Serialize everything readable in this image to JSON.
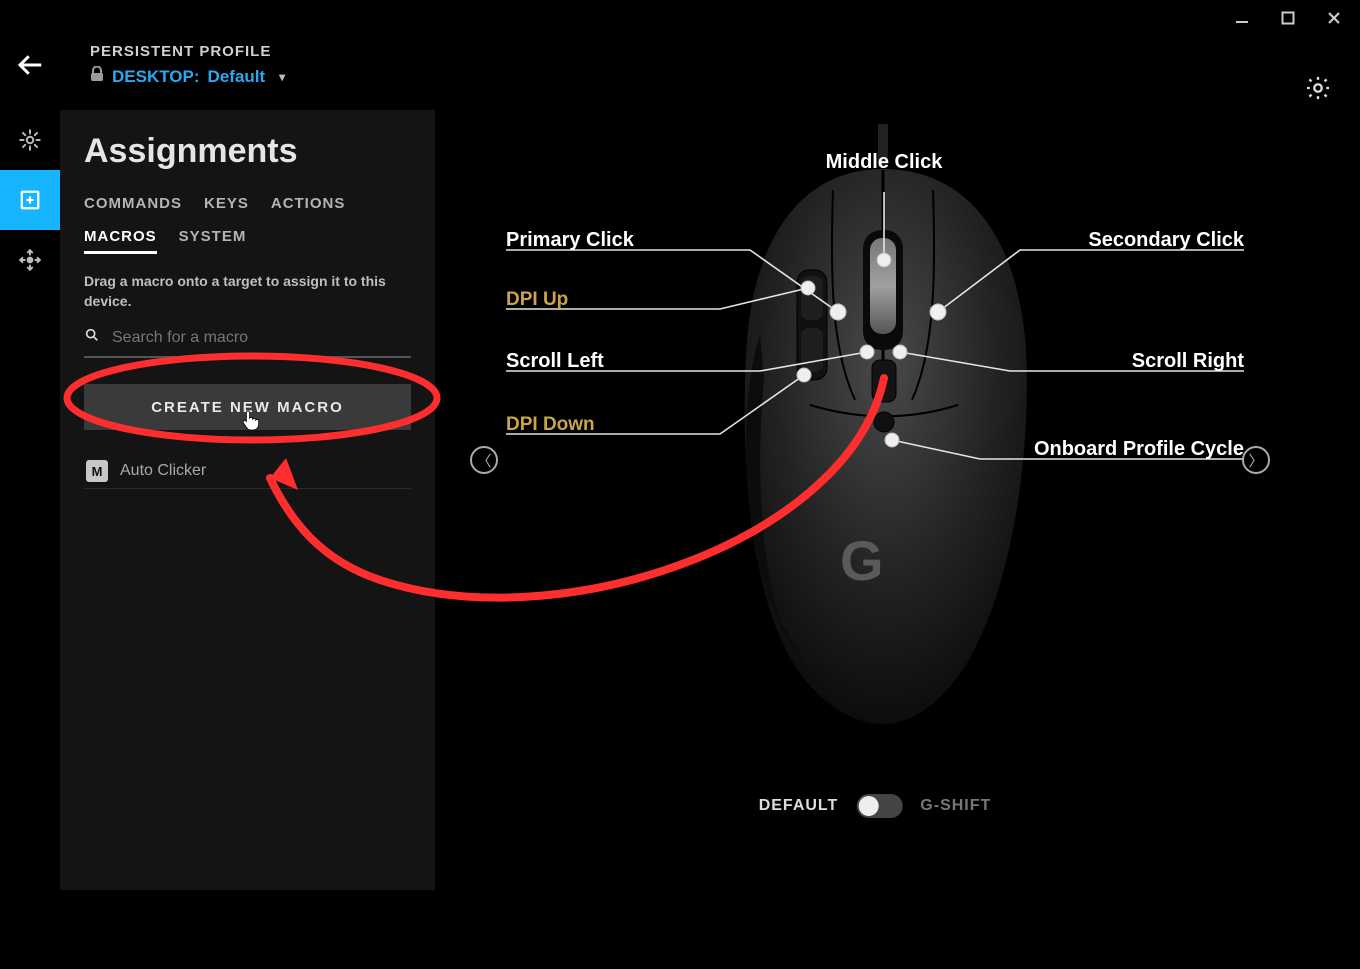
{
  "header": {
    "profile_label": "PERSISTENT PROFILE",
    "profile_location_label": "DESKTOP:",
    "profile_name": "Default"
  },
  "sidebar": {
    "title": "Assignments",
    "tabs_row1": [
      "COMMANDS",
      "KEYS",
      "ACTIONS"
    ],
    "tabs_row2": [
      "MACROS",
      "SYSTEM"
    ],
    "active_tab": "MACROS",
    "help_text": "Drag a macro onto a target to assign it to this device.",
    "search_placeholder": "Search for a macro",
    "create_label": "CREATE NEW MACRO",
    "macro_list": [
      {
        "badge": "M",
        "name": "Auto Clicker"
      }
    ]
  },
  "diagram": {
    "labels": {
      "middle": "Middle Click",
      "primary": "Primary Click",
      "secondary": "Secondary Click",
      "dpi_up": "DPI Up",
      "dpi_down": "DPI Down",
      "scroll_left": "Scroll Left",
      "scroll_right": "Scroll Right",
      "profile_cycle": "Onboard Profile Cycle"
    }
  },
  "footer": {
    "default_label": "DEFAULT",
    "gshift_label": "G-SHIFT"
  },
  "colors": {
    "accent": "#2aa8f0",
    "highlight": "#ff2e2e",
    "dpi": "#c9a547"
  }
}
